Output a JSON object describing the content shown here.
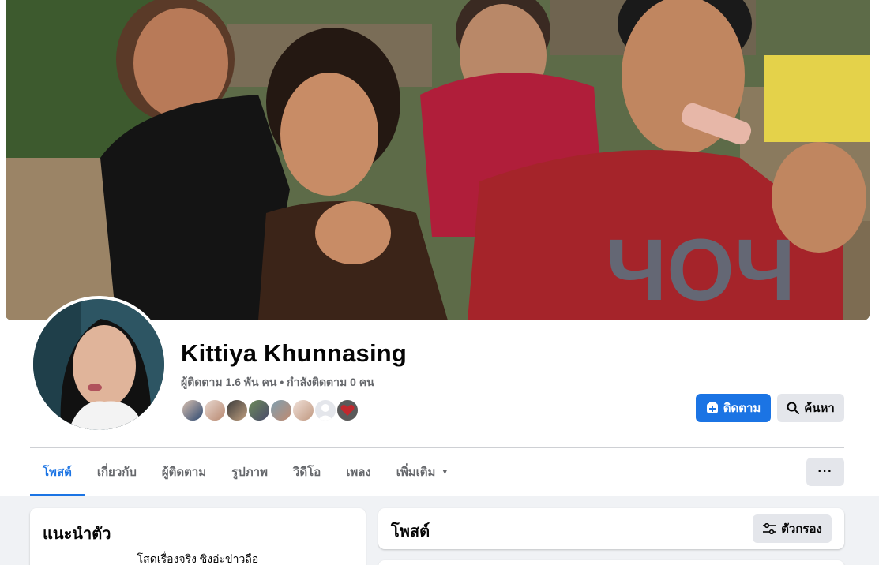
{
  "profile": {
    "name": "Kittiya Khunnasing",
    "stats": "ผู้ติดตาม 1.6 พัน คน • กำลังติดตาม 0 คน"
  },
  "actions": {
    "follow_label": "ติดตาม",
    "search_label": "ค้นหา"
  },
  "tabs": [
    {
      "label": "โพสต์",
      "active": true
    },
    {
      "label": "เกี่ยวกับ"
    },
    {
      "label": "ผู้ติดตาม"
    },
    {
      "label": "รูปภาพ"
    },
    {
      "label": "วิดีโอ"
    },
    {
      "label": "เพลง"
    },
    {
      "label": "เพิ่มเติม"
    }
  ],
  "more_button": "···",
  "intro": {
    "title": "แนะนำตัว",
    "bio": "โสดเรื่องจริง ซิงอ่ะข่าวลือ"
  },
  "posts": {
    "title": "โพสต์",
    "filter_label": "ตัวกรอง"
  },
  "colors": {
    "accent": "#1b74e4",
    "secondary_button": "#e4e6eb",
    "page_bg": "#f0f2f5"
  },
  "icons": {
    "follow": "follow-plus-icon",
    "search": "magnifier-icon",
    "more_caret": "caret-down-icon",
    "filter": "sliders-icon"
  }
}
